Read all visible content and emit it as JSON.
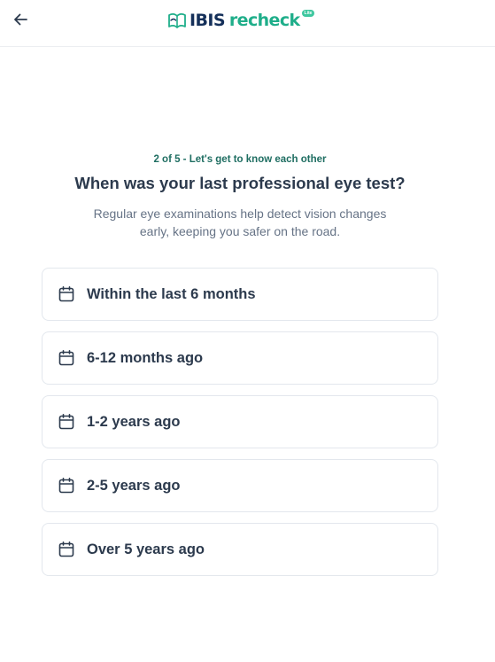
{
  "header": {
    "back_icon": "arrow-left-icon",
    "logo": {
      "brand": "IBIS",
      "product": "recheck",
      "badge": "Lite",
      "icon": "eye-book-logo-icon"
    }
  },
  "colors": {
    "brand_navy": "#15305a",
    "brand_green": "#1fae8a",
    "step_text": "#1f6e62",
    "heading": "#2c3a4d",
    "body_text": "#667386",
    "card_border": "#e3e7ed"
  },
  "step_label": "2 of 5 - Let's get to know each other",
  "question": "When was your last professional eye test?",
  "subtitle": "Regular eye examinations help detect vision changes early, keeping you safer on the road.",
  "options": [
    {
      "label": "Within the last 6 months",
      "icon": "calendar-icon"
    },
    {
      "label": "6-12 months ago",
      "icon": "calendar-icon"
    },
    {
      "label": "1-2 years ago",
      "icon": "calendar-icon"
    },
    {
      "label": "2-5 years ago",
      "icon": "calendar-icon"
    },
    {
      "label": "Over 5 years ago",
      "icon": "calendar-icon"
    }
  ]
}
